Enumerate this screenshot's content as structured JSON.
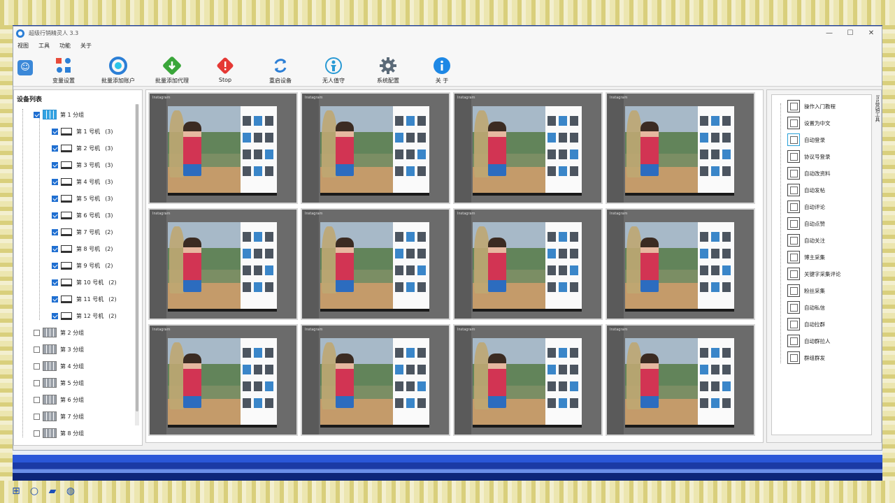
{
  "window": {
    "title": "超级行销精灵人 3.3",
    "controls": [
      "—",
      "☐",
      "✕"
    ]
  },
  "menu": [
    "视图",
    "工具",
    "功能",
    "关于"
  ],
  "toolbar": [
    {
      "id": "var-settings",
      "label": "变量设置",
      "icon": "dots-settings-icon",
      "color": "#e84b3a"
    },
    {
      "id": "batch-add-account",
      "label": "批量添加账户",
      "icon": "circle-gradient-icon",
      "color": "#2c7fd6"
    },
    {
      "id": "batch-add-proxy",
      "label": "批量添加代理",
      "icon": "download-arrow-icon",
      "color": "#3aa63a"
    },
    {
      "id": "stop",
      "label": "Stop",
      "icon": "warning-icon",
      "color": "#e53935"
    },
    {
      "id": "restart-device",
      "label": "重启设备",
      "icon": "refresh-icon",
      "color": "#2c7fd6"
    },
    {
      "id": "unattended",
      "label": "无人值守",
      "icon": "person-icon",
      "color": "#2a9ad4"
    },
    {
      "id": "system-config",
      "label": "系统配置",
      "icon": "gear-icon",
      "color": "#5b6a78"
    },
    {
      "id": "about",
      "label": "关 于",
      "icon": "info-icon",
      "color": "#1e88e5"
    }
  ],
  "device_list": {
    "title": "设备列表",
    "group1": {
      "label": "第 1 分组",
      "checked": true
    },
    "devices": [
      {
        "label": "第 1 号机",
        "count": "(3)"
      },
      {
        "label": "第 2 号机",
        "count": "(3)"
      },
      {
        "label": "第 3 号机",
        "count": "(3)"
      },
      {
        "label": "第 4 号机",
        "count": "(3)"
      },
      {
        "label": "第 5 号机",
        "count": "(3)"
      },
      {
        "label": "第 6 号机",
        "count": "(3)"
      },
      {
        "label": "第 7 号机",
        "count": "(2)"
      },
      {
        "label": "第 8 号机",
        "count": "(2)"
      },
      {
        "label": "第 9 号机",
        "count": "(2)"
      },
      {
        "label": "第 10 号机",
        "count": "(2)"
      },
      {
        "label": "第 11 号机",
        "count": "(2)"
      },
      {
        "label": "第 12 号机",
        "count": "(2)"
      }
    ],
    "groups": [
      "第 2 分组",
      "第 3 分组",
      "第 4 分组",
      "第 5 分组",
      "第 6 分组",
      "第 7 分组",
      "第 8 分组"
    ]
  },
  "screens": {
    "app_name": "Instagram"
  },
  "functions": {
    "tab_label": "Ins营销工具",
    "items": [
      {
        "label": "操作入门教程",
        "active": false
      },
      {
        "label": "设置为中文",
        "active": false
      },
      {
        "label": "自动登录",
        "active": true
      },
      {
        "label": "协议号登录",
        "active": false
      },
      {
        "label": "自动改资料",
        "active": false
      },
      {
        "label": "自动发帖",
        "active": false
      },
      {
        "label": "自动评论",
        "active": false
      },
      {
        "label": "自动点赞",
        "active": false
      },
      {
        "label": "自动关注",
        "active": false
      },
      {
        "label": "博主采集",
        "active": false
      },
      {
        "label": "关键字采集评论",
        "active": false
      },
      {
        "label": "粉丝采集",
        "active": false
      },
      {
        "label": "自动私信",
        "active": false
      },
      {
        "label": "自动拉群",
        "active": false
      },
      {
        "label": "自动群拉人",
        "active": false
      },
      {
        "label": "群组群发",
        "active": false
      }
    ]
  }
}
